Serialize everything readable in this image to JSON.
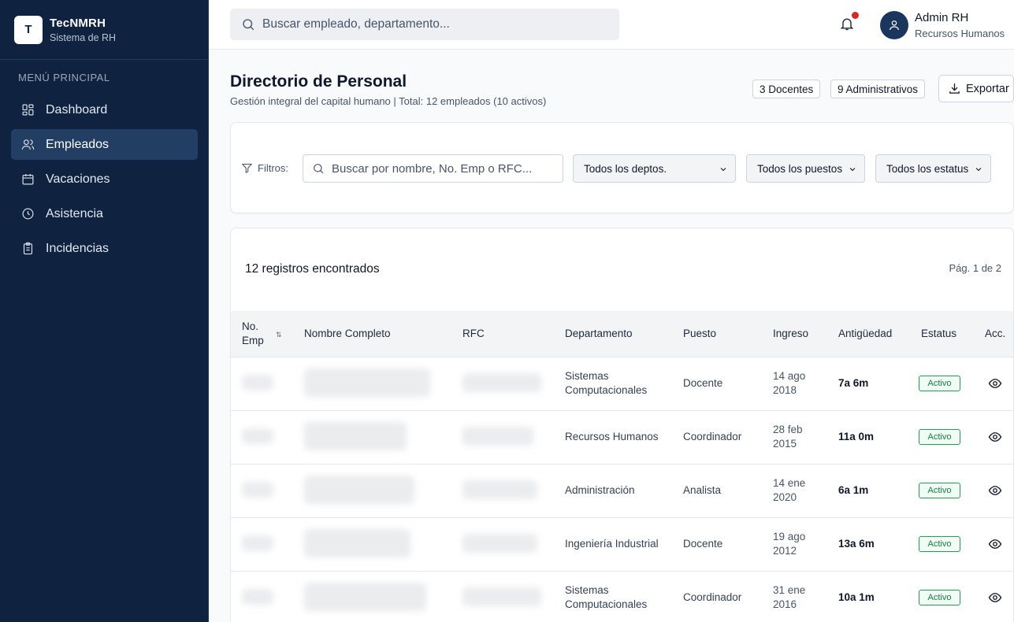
{
  "brand": {
    "logo_letter": "T",
    "name": "TecNMRH",
    "subtitle": "Sistema de RH"
  },
  "sidebar": {
    "section_title": "MENÚ PRINCIPAL",
    "items": [
      {
        "label": "Dashboard",
        "icon": "dashboard-icon"
      },
      {
        "label": "Empleados",
        "icon": "users-icon",
        "active": true
      },
      {
        "label": "Vacaciones",
        "icon": "calendar-icon"
      },
      {
        "label": "Asistencia",
        "icon": "clock-icon"
      },
      {
        "label": "Incidencias",
        "icon": "clipboard-icon"
      }
    ]
  },
  "topbar": {
    "search_placeholder": "Buscar empleado, departamento...",
    "user_name": "Admin RH",
    "user_role": "Recursos Humanos"
  },
  "header": {
    "title": "Directorio de Personal",
    "subtitle": "Gestión integral del capital humano | Total: 12 empleados (10 activos)",
    "badge_docentes": "3 Docentes",
    "badge_admin": "9 Administrativos",
    "export_label": "Exportar"
  },
  "filters": {
    "label": "Filtros:",
    "search_placeholder": "Buscar por nombre, No. Emp o RFC...",
    "dept": "Todos los deptos.",
    "puesto": "Todos los puestos",
    "estatus": "Todos los estatus"
  },
  "table": {
    "records_label": "12 registros encontrados",
    "page_label": "Pág. 1 de 2",
    "columns": {
      "no_emp": "No. Emp",
      "nombre": "Nombre Completo",
      "rfc": "RFC",
      "departamento": "Departamento",
      "puesto": "Puesto",
      "ingreso": "Ingreso",
      "antiguedad": "Antigüedad",
      "estatus": "Estatus",
      "acciones": "Acc."
    },
    "rows": [
      {
        "departamento": "Sistemas Computacionales",
        "puesto": "Docente",
        "ingreso": "14 ago 2018",
        "antiguedad": "7a 6m",
        "estatus": "Activo"
      },
      {
        "departamento": "Recursos Humanos",
        "puesto": "Coordinador",
        "ingreso": "28 feb 2015",
        "antiguedad": "11a 0m",
        "estatus": "Activo"
      },
      {
        "departamento": "Administración",
        "puesto": "Analista",
        "ingreso": "14 ene 2020",
        "antiguedad": "6a 1m",
        "estatus": "Activo"
      },
      {
        "departamento": "Ingeniería Industrial",
        "puesto": "Docente",
        "ingreso": "19 ago 2012",
        "antiguedad": "13a 6m",
        "estatus": "Activo"
      },
      {
        "departamento": "Sistemas Computacionales",
        "puesto": "Coordinador",
        "ingreso": "31 ene 2016",
        "antiguedad": "10a 1m",
        "estatus": "Activo"
      }
    ]
  },
  "colors": {
    "sidebar_bg": "#0f2340",
    "active_item": "#233e63",
    "status_green": "#15803d",
    "notification_dot": "#dc2626"
  }
}
